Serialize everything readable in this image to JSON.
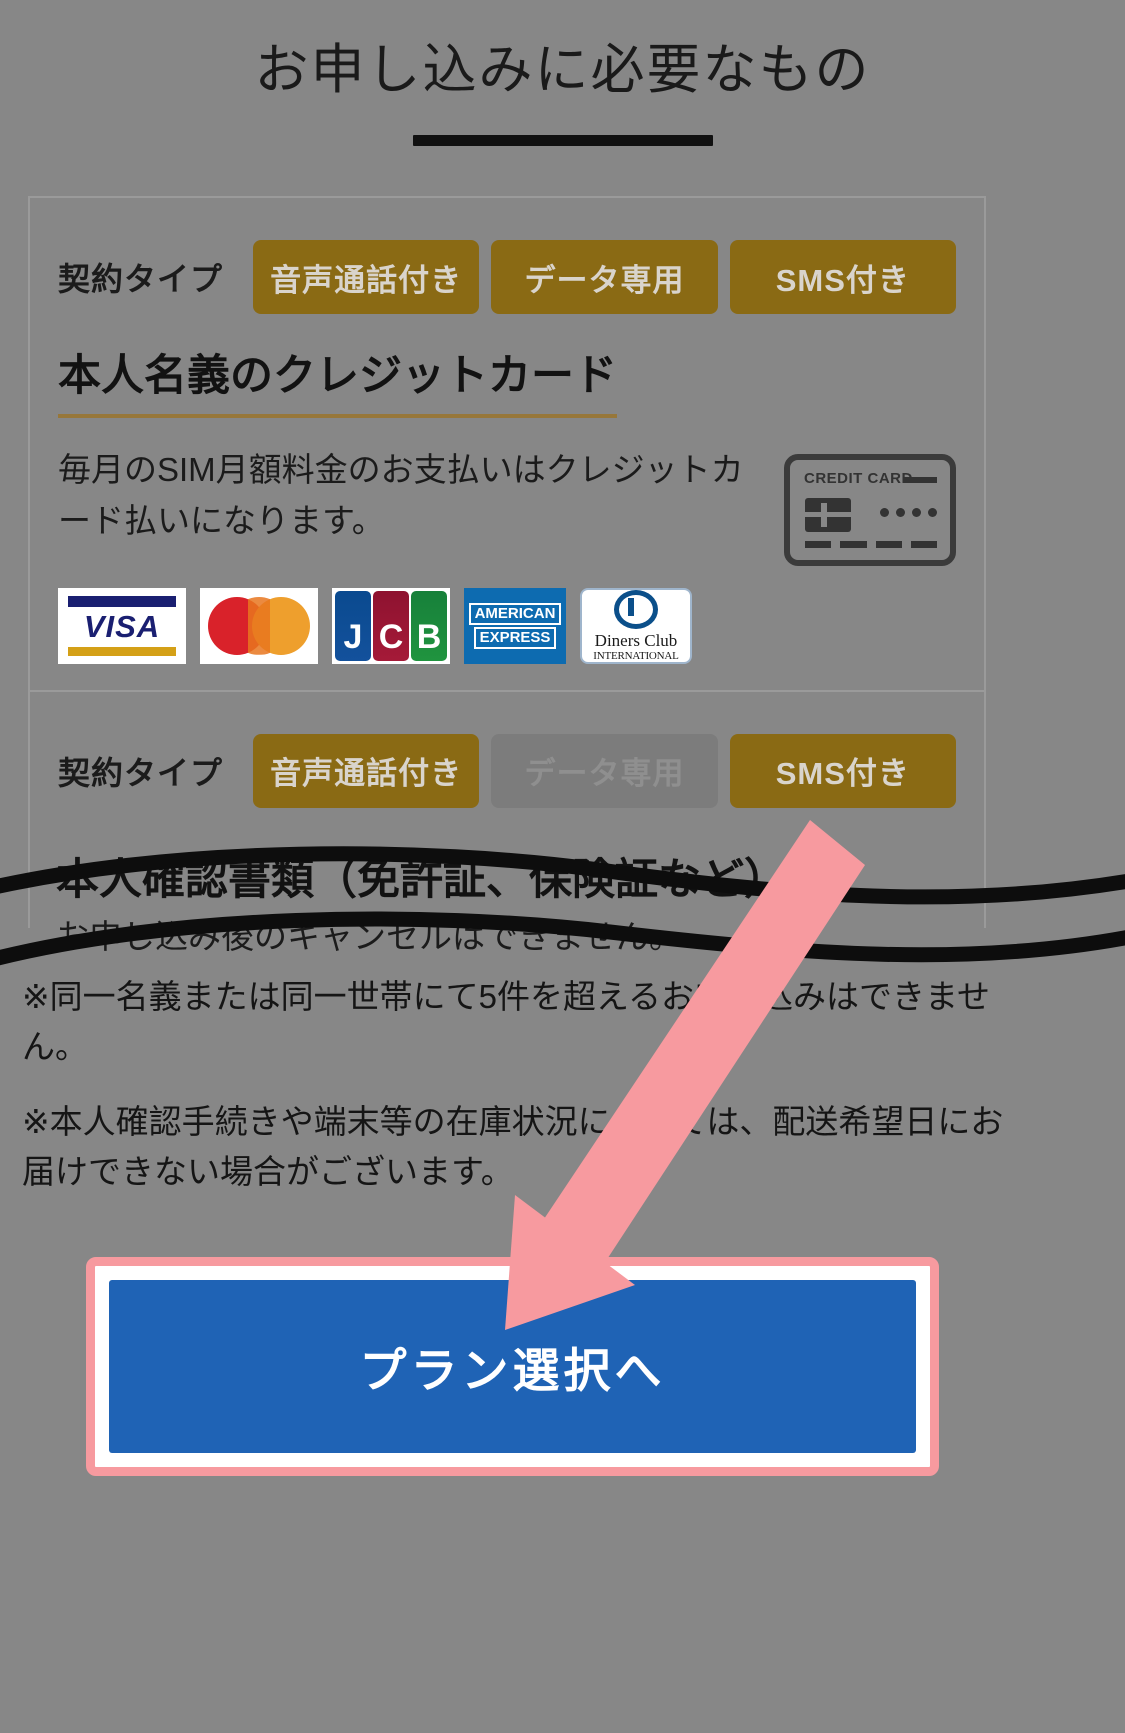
{
  "page": {
    "title": "お申し込みに必要なもの",
    "background_color": "#878787"
  },
  "card": {
    "section_one": {
      "contract_type_label": "契約タイプ",
      "options": [
        {
          "label": "音声通話付き",
          "state": "enabled"
        },
        {
          "label": "データ専用",
          "state": "enabled"
        },
        {
          "label": "SMS付き",
          "state": "enabled"
        }
      ],
      "heading": "本人名義のクレジットカード",
      "body": "毎月のSIM月額料金のお支払いはクレジットカード払いになります。",
      "card_icon_label": "CREDIT CARD",
      "brands": [
        {
          "name": "VISA",
          "word": "VISA"
        },
        {
          "name": "Mastercard",
          "word": ""
        },
        {
          "name": "JCB",
          "letters": [
            "J",
            "C",
            "B"
          ]
        },
        {
          "name": "American Express",
          "line1": "AMERICAN",
          "line2": "EXPRESS"
        },
        {
          "name": "Diners Club",
          "line1": "Diners Club",
          "line2": "INTERNATIONAL"
        }
      ]
    },
    "section_two": {
      "contract_type_label": "契約タイプ",
      "options": [
        {
          "label": "音声通話付き",
          "state": "enabled"
        },
        {
          "label": "データ専用",
          "state": "disabled"
        },
        {
          "label": "SMS付き",
          "state": "enabled"
        }
      ],
      "heading_partial": "本人確認書類（免許証、保険証など）",
      "body_partial": "お申し込み後のキャンセルはできません。"
    }
  },
  "notes": [
    "※同一名義または同一世帯にて5件を超えるお申し込みはできません。",
    "※本人確認手続きや端末等の在庫状況によっては、配送希望日にお届けできない場合がございます。"
  ],
  "cta": {
    "label": "プラン選択へ",
    "button_color": "#1f63b5",
    "highlight_color": "#f79a9f"
  },
  "annotations": {
    "arrow_color": "#f79a9f",
    "scribble_color": "#0d0d0d"
  }
}
